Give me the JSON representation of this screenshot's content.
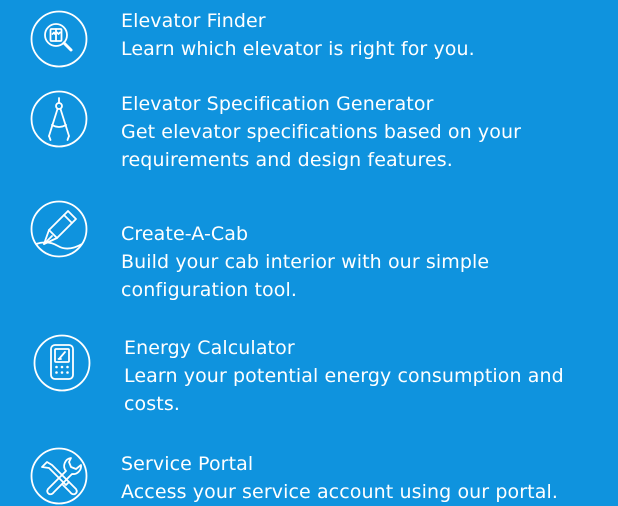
{
  "tools": [
    {
      "icon": "search-elevator-icon",
      "title": "Elevator Finder",
      "desc": "Learn which elevator is right for you."
    },
    {
      "icon": "compass-icon",
      "title": "Elevator Specification Generator",
      "desc": "Get elevator specifications based on your requirements and design features."
    },
    {
      "icon": "pen-nib-icon",
      "title": "Create-A-Cab",
      "desc": "Build your cab interior with our simple configuration tool."
    },
    {
      "icon": "calculator-icon",
      "title": "Energy Calculator",
      "desc": "Learn your potential energy consumption and costs."
    },
    {
      "icon": "wrench-screwdriver-icon",
      "title": "Service Portal",
      "desc": "Access your service account using our portal."
    }
  ],
  "colors": {
    "background": "#0F93DE",
    "foreground": "#FFFFFF"
  }
}
